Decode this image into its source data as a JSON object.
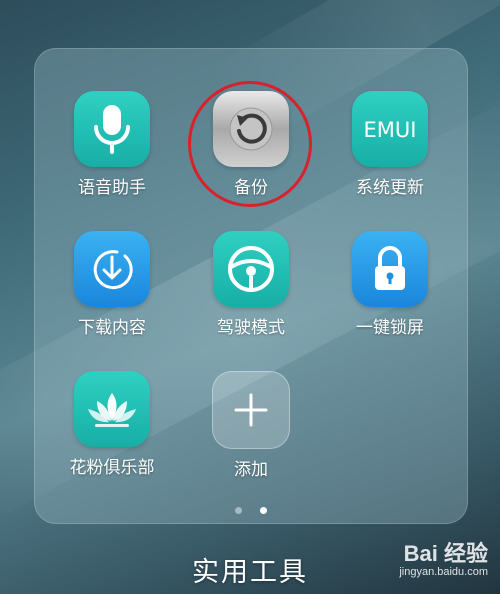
{
  "folder": {
    "title": "实用工具",
    "apps": [
      {
        "label": "语音助手",
        "icon": "microphone-icon",
        "color": "#1fbfb5"
      },
      {
        "label": "备份",
        "icon": "backup-restore-icon",
        "color": "#b8b8b8",
        "highlighted": true
      },
      {
        "label": "系统更新",
        "icon": "emui-logo-icon",
        "icon_text": "EMUI",
        "color": "#1fbfb5"
      },
      {
        "label": "下载内容",
        "icon": "download-icon",
        "color": "#2a9be8"
      },
      {
        "label": "驾驶模式",
        "icon": "steering-wheel-icon",
        "color": "#1fbfb5"
      },
      {
        "label": "一键锁屏",
        "icon": "lock-icon",
        "color": "#2a9be8"
      },
      {
        "label": "花粉俱乐部",
        "icon": "lotus-icon",
        "color": "#1fbfb5"
      },
      {
        "label": "添加",
        "icon": "plus-icon",
        "color": "#ffffff"
      }
    ],
    "pages": {
      "count": 2,
      "active": 2
    }
  },
  "annotation": {
    "color": "#d8212b"
  },
  "watermark": {
    "logo": "Bai 经验",
    "url": "jingyan.baidu.com"
  }
}
